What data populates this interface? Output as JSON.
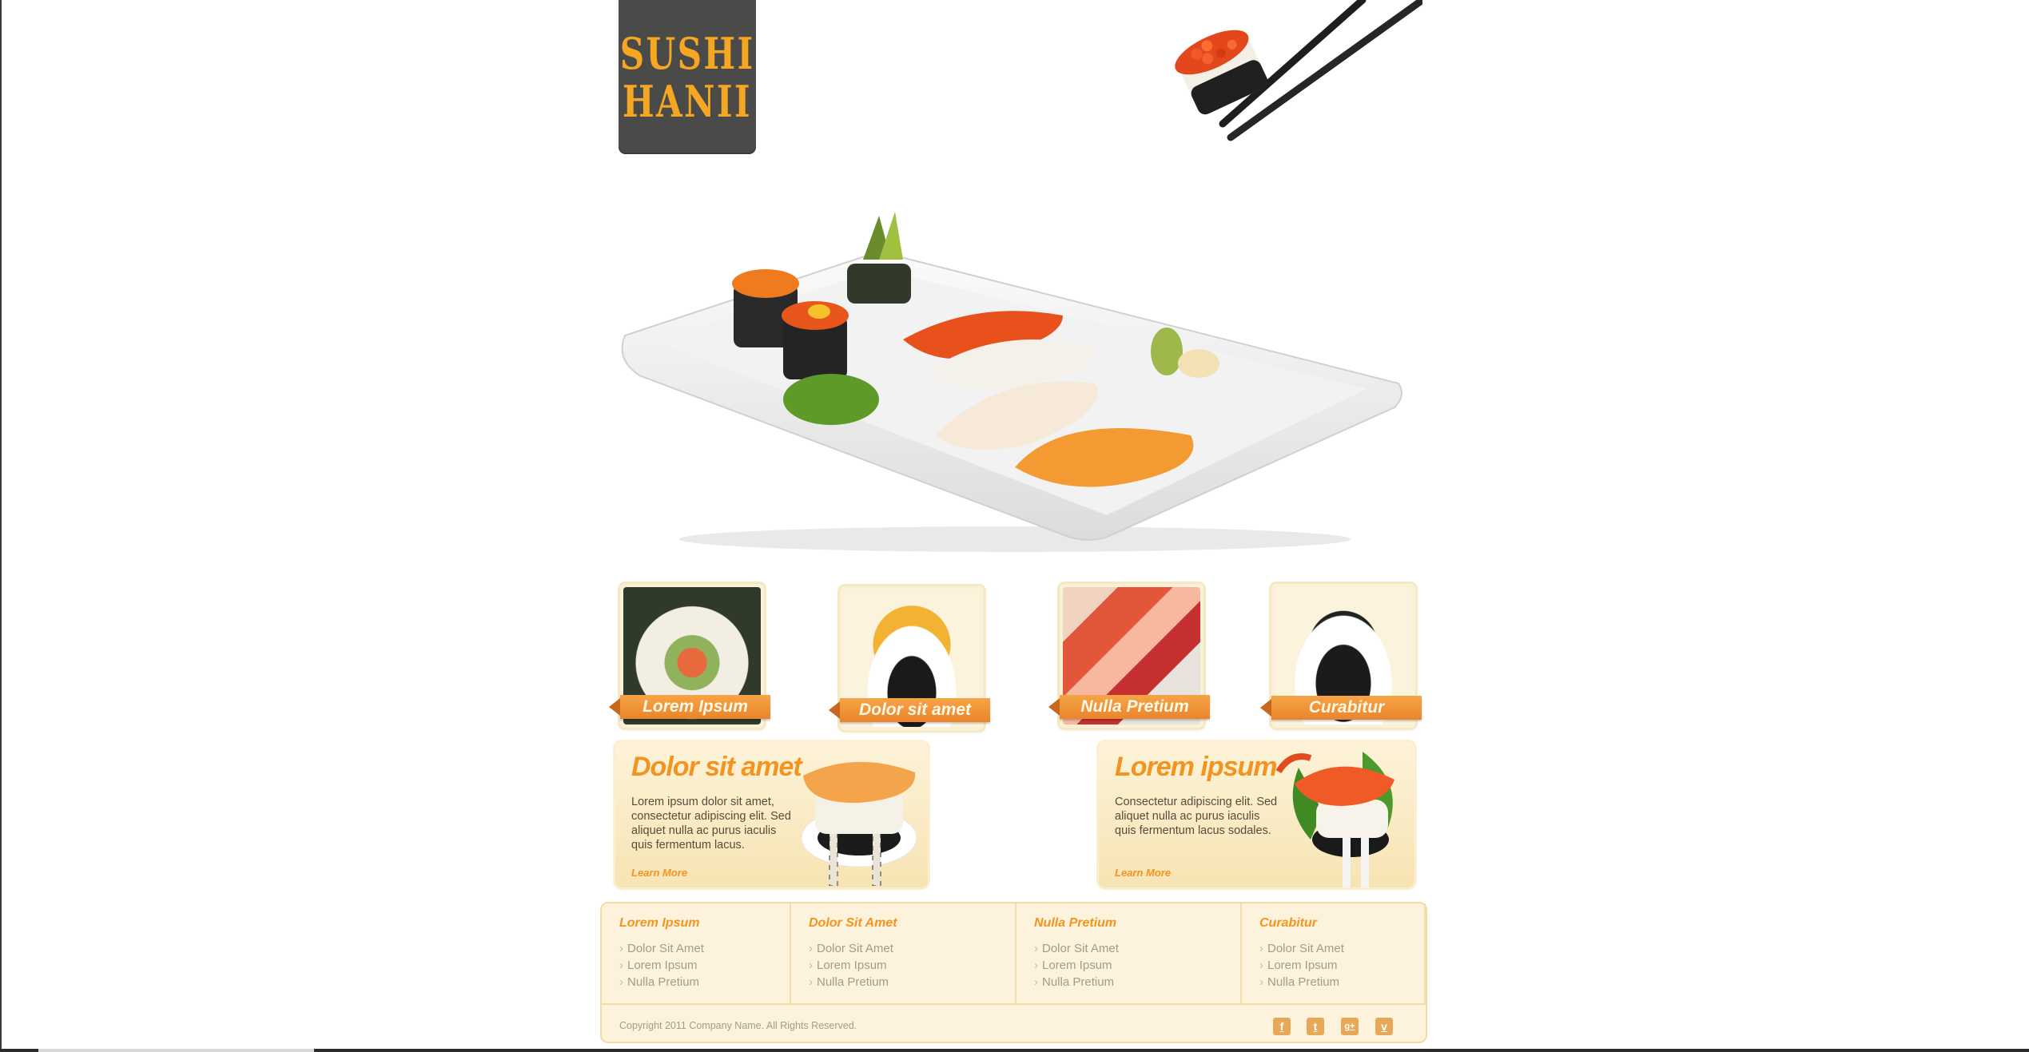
{
  "logo": {
    "line1": "SUSHI",
    "line2": "HANII"
  },
  "thumbnails": [
    {
      "label": "Lorem Ipsum"
    },
    {
      "label": "Dolor sit amet"
    },
    {
      "label": "Nulla Pretium"
    },
    {
      "label": "Curabitur"
    }
  ],
  "promos": [
    {
      "title": "Dolor sit amet",
      "text": "Lorem ipsum dolor sit amet, consectetur adipiscing elit. Sed aliquet nulla ac purus iaculis quis fermentum lacus.",
      "link": "Learn More"
    },
    {
      "title": "Lorem ipsum",
      "text": "Consectetur adipiscing elit. Sed aliquet nulla ac purus iaculis quis fermentum lacus sodales.",
      "link": "Learn More"
    }
  ],
  "footer": {
    "columns": [
      {
        "title": "Lorem Ipsum",
        "items": [
          "Dolor Sit Amet",
          "Lorem Ipsum",
          "Nulla Pretium"
        ]
      },
      {
        "title": "Dolor Sit Amet",
        "items": [
          "Dolor Sit Amet",
          "Lorem Ipsum",
          "Nulla Pretium"
        ]
      },
      {
        "title": "Nulla Pretium",
        "items": [
          "Dolor Sit Amet",
          "Lorem Ipsum",
          "Nulla Pretium"
        ]
      },
      {
        "title": "Curabitur",
        "items": [
          "Dolor Sit Amet",
          "Lorem Ipsum",
          "Nulla Pretium"
        ]
      }
    ],
    "copyright": "Copyright 2011 Company Name.  All Rights Reserved.",
    "social": [
      {
        "icon": "facebook-icon",
        "glyph": "f"
      },
      {
        "icon": "twitter-icon",
        "glyph": "t"
      },
      {
        "icon": "google-plus-icon",
        "glyph": "g+"
      },
      {
        "icon": "vimeo-icon",
        "glyph": "v"
      }
    ]
  },
  "colors": {
    "accent": "#f2941f",
    "ribbon": "#f0953a",
    "logo_bg": "#4a4a49",
    "footer_bg": "#fdf3dc"
  }
}
